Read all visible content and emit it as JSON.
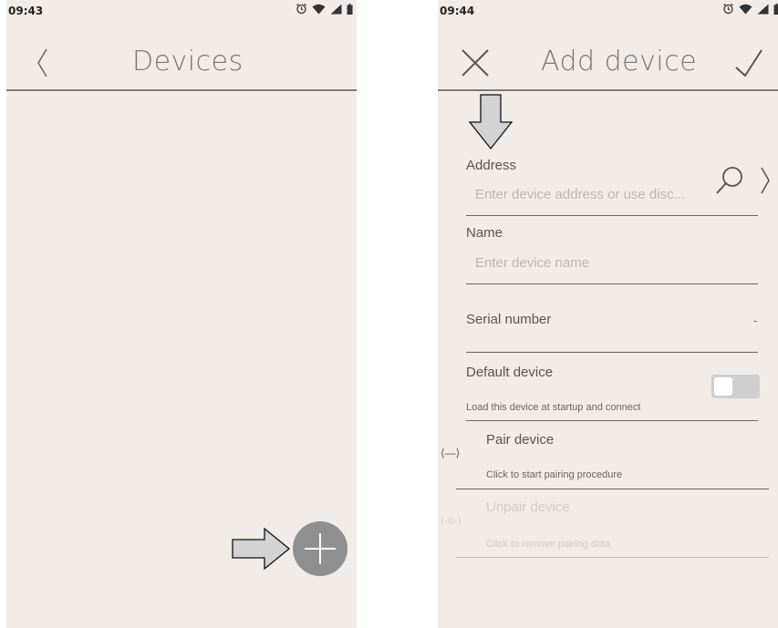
{
  "devices_screen": {
    "time": "09:43",
    "title": "Devices",
    "back_icon": "chevron-left-icon",
    "add_icon": "plus-icon"
  },
  "add_device_screen": {
    "time": "09:44",
    "title": "Add device",
    "cancel_icon": "close-icon",
    "confirm_icon": "checkmark-icon",
    "address": {
      "label": "Address",
      "placeholder": "Enter device address or use disc..."
    },
    "name": {
      "label": "Name",
      "placeholder": "Enter device name"
    },
    "serial": {
      "label": "Serial number",
      "value": "-"
    },
    "default_device": {
      "label": "Default device",
      "description": "Load this device at startup and connect",
      "enabled": false
    },
    "pair": {
      "label": "Pair device",
      "description": "Click to start pairing procedure",
      "icon_text": "⟨—⟩"
    },
    "unpair": {
      "label": "Unpair device",
      "description": "Click to remove pairing data",
      "icon_text": "⟨-⊙-⟩"
    }
  },
  "colors": {
    "screen_bg": "#f1ece8",
    "fab": "#8f8f8f",
    "annotation_arrow": "#d3d3d3"
  }
}
